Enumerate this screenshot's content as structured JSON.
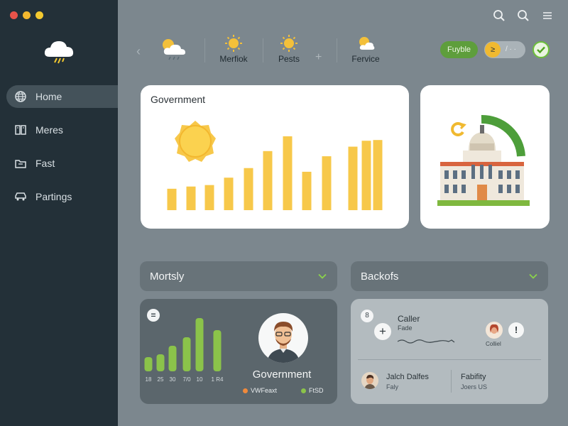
{
  "window": {
    "traffic_colors": [
      "#e8534a",
      "#f3b72e",
      "#f3c930"
    ]
  },
  "sidebar": {
    "logo": "cloud-lightning-icon",
    "items": [
      {
        "label": "Home",
        "icon": "globe-icon",
        "active": true
      },
      {
        "label": "Meres",
        "icon": "book-icon",
        "active": false
      },
      {
        "label": "Fast",
        "icon": "folder-icon",
        "active": false
      },
      {
        "label": "Partings",
        "icon": "car-icon",
        "active": false
      }
    ]
  },
  "topbar": {
    "icons": [
      "search-icon",
      "search-icon",
      "menu-icon"
    ]
  },
  "weather": {
    "main_icon": "partly-cloudy-rain-icon",
    "items": [
      {
        "label": "Merfiok",
        "icon": "sun-icon"
      },
      {
        "label": "Pests",
        "icon": "sun-icon"
      },
      {
        "label": "Fervice",
        "icon": "partly-cloudy-icon"
      }
    ]
  },
  "status": {
    "pill_label": "Fuyble",
    "toggle_knob": "≥",
    "toggle_text": "/ · ·",
    "accent_green": "#5e9e3c",
    "accent_yellow": "#f0b930"
  },
  "main_card": {
    "title": "Government",
    "bar_color": "#f7c84a",
    "chart_data": {
      "type": "bar",
      "title": "Government",
      "values": [
        29,
        32,
        34,
        44,
        57,
        80,
        100,
        52,
        73,
        86,
        94,
        95
      ],
      "ylim": [
        0,
        100
      ]
    }
  },
  "building_card": {
    "icon": "government-building-icon"
  },
  "dropdowns": [
    {
      "label": "Mortsly"
    },
    {
      "label": "Backofs"
    }
  ],
  "left_panel": {
    "badge": "=",
    "bar_color": "#8bc34a",
    "chart_data": {
      "type": "bar",
      "categories": [
        "18",
        "25",
        "30",
        "7/0",
        "10",
        "1 R4"
      ],
      "values": [
        20,
        24,
        36,
        48,
        75,
        58
      ],
      "ylim": [
        0,
        80
      ]
    },
    "person_name": "Government",
    "legend": [
      {
        "label": "VWFeaxt",
        "color": "#f08a3c"
      },
      {
        "label": "FtSD",
        "color": "#8bc34a"
      }
    ]
  },
  "right_panel": {
    "badge": "8",
    "caller_title": "Caller",
    "caller_sub": "Fade",
    "right_user_label": "Colliel",
    "rows": [
      {
        "name": "Jalch Dalfes",
        "sub": "Faly"
      },
      {
        "name": "Fabifity",
        "sub": "Joers US"
      }
    ]
  }
}
